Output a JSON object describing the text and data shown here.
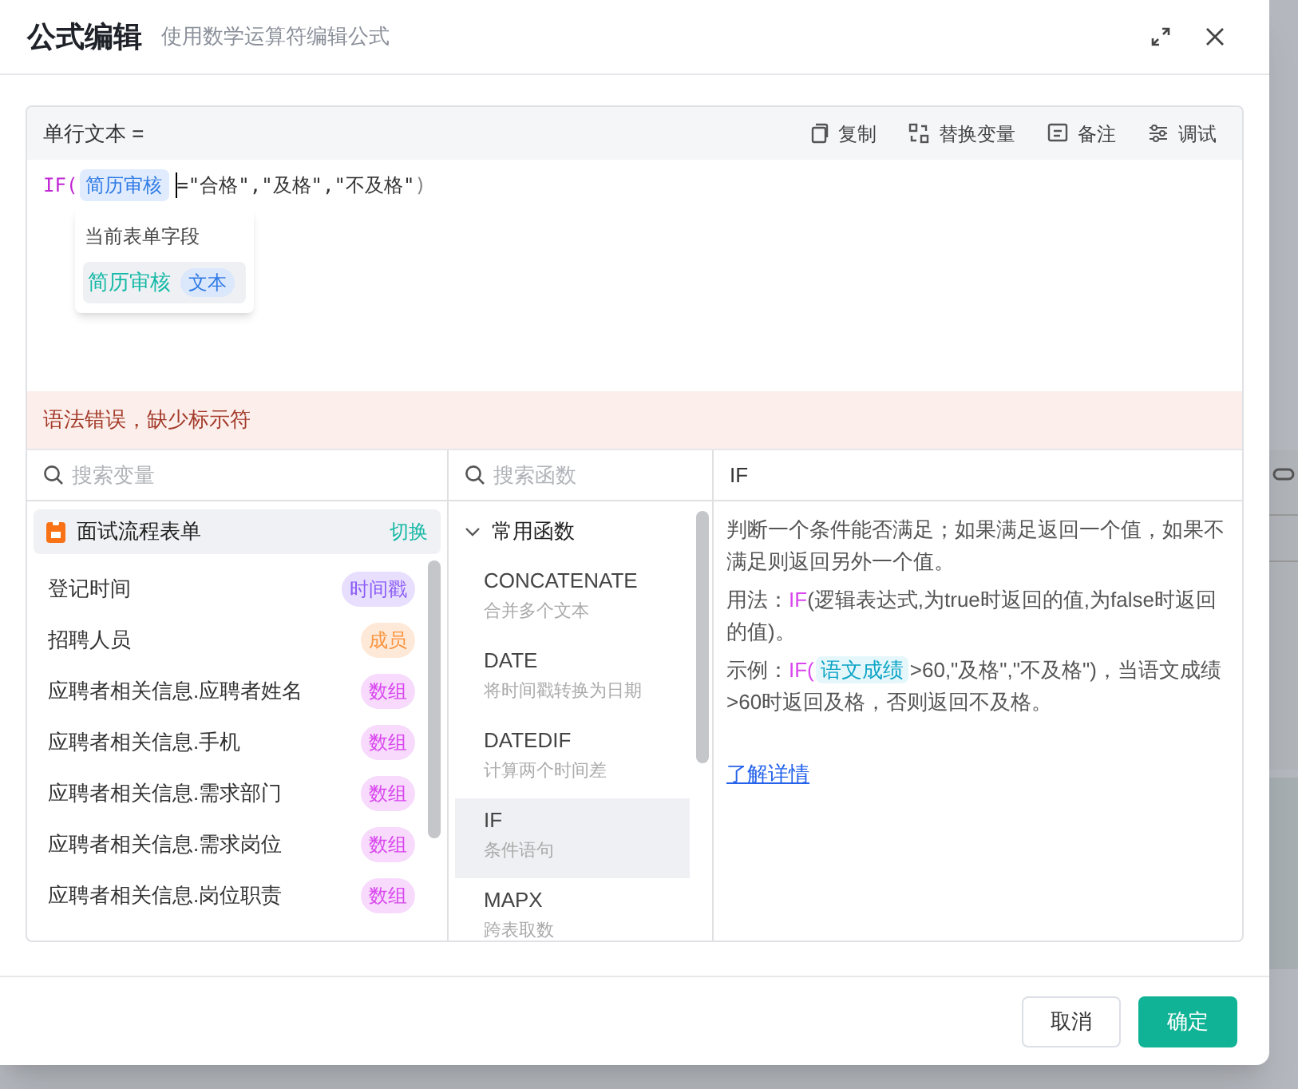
{
  "dialog": {
    "title": "公式编辑",
    "subtitle": "使用数学运算符编辑公式"
  },
  "editor": {
    "field_label": "单行文本 =",
    "tools": [
      {
        "kind": "copy",
        "label": "复制"
      },
      {
        "kind": "replace",
        "label": "替换变量"
      },
      {
        "kind": "note",
        "label": "备注"
      },
      {
        "kind": "debug",
        "label": "调试"
      }
    ],
    "formula": [
      {
        "kind": "func",
        "text": "IF("
      },
      {
        "kind": "field",
        "text": "简历审核"
      },
      {
        "kind": "cursor"
      },
      {
        "kind": "plain",
        "text": "=\"合格\",\"及格\",\"不及格\""
      },
      {
        "kind": "paren",
        "text": ")"
      }
    ],
    "suggest": {
      "heading": "当前表单字段",
      "items": [
        {
          "name": "简历审核",
          "type": "文本",
          "selected": true
        }
      ]
    },
    "error": "语法错误，缺少标示符"
  },
  "variables": {
    "placeholder": "搜索变量",
    "form": {
      "name": "面试流程表单",
      "action": "切换"
    },
    "items": [
      {
        "name": "登记时间",
        "type": "时间戳",
        "color": "#8b5cf6"
      },
      {
        "name": "招聘人员",
        "type": "成员",
        "color": "#fb923c"
      },
      {
        "name": "应聘者相关信息.应聘者姓名",
        "type": "数组",
        "color": "#d946ef"
      },
      {
        "name": "应聘者相关信息.手机",
        "type": "数组",
        "color": "#d946ef"
      },
      {
        "name": "应聘者相关信息.需求部门",
        "type": "数组",
        "color": "#d946ef"
      },
      {
        "name": "应聘者相关信息.需求岗位",
        "type": "数组",
        "color": "#d946ef"
      },
      {
        "name": "应聘者相关信息.岗位职责",
        "type": "数组",
        "color": "#d946ef"
      }
    ]
  },
  "functions": {
    "placeholder": "搜索函数",
    "category": {
      "name": "常用函数",
      "expanded": true
    },
    "items": [
      {
        "name": "CONCATENATE",
        "desc": "合并多个文本",
        "selected": false
      },
      {
        "name": "DATE",
        "desc": "将时间戳转换为日期",
        "selected": false
      },
      {
        "name": "DATEDIF",
        "desc": "计算两个时间差",
        "selected": false
      },
      {
        "name": "IF",
        "desc": "条件语句",
        "selected": true
      },
      {
        "name": "MAPX",
        "desc": "跨表取数",
        "selected": false
      }
    ]
  },
  "help": {
    "title": "IF",
    "description": "判断一个条件能否满足；如果满足返回一个值，如果不满足则返回另外一个值。",
    "usage": [
      {
        "kind": "text",
        "text": "用法："
      },
      {
        "kind": "func",
        "text": "IF"
      },
      {
        "kind": "text",
        "text": "(逻辑表达式,为true时返回的值,为false时返回的值)。"
      }
    ],
    "example": [
      {
        "kind": "text",
        "text": "示例："
      },
      {
        "kind": "func",
        "text": "IF("
      },
      {
        "kind": "field",
        "text": "语文成绩"
      },
      {
        "kind": "text",
        "text": ">60,\"及格\",\"不及格\")，当语文成绩>60时返回及格，否则返回不及格。"
      }
    ],
    "link": "了解详情"
  },
  "buttons": [
    {
      "label": "取消",
      "primary": false
    },
    {
      "label": "确定",
      "primary": true
    }
  ]
}
